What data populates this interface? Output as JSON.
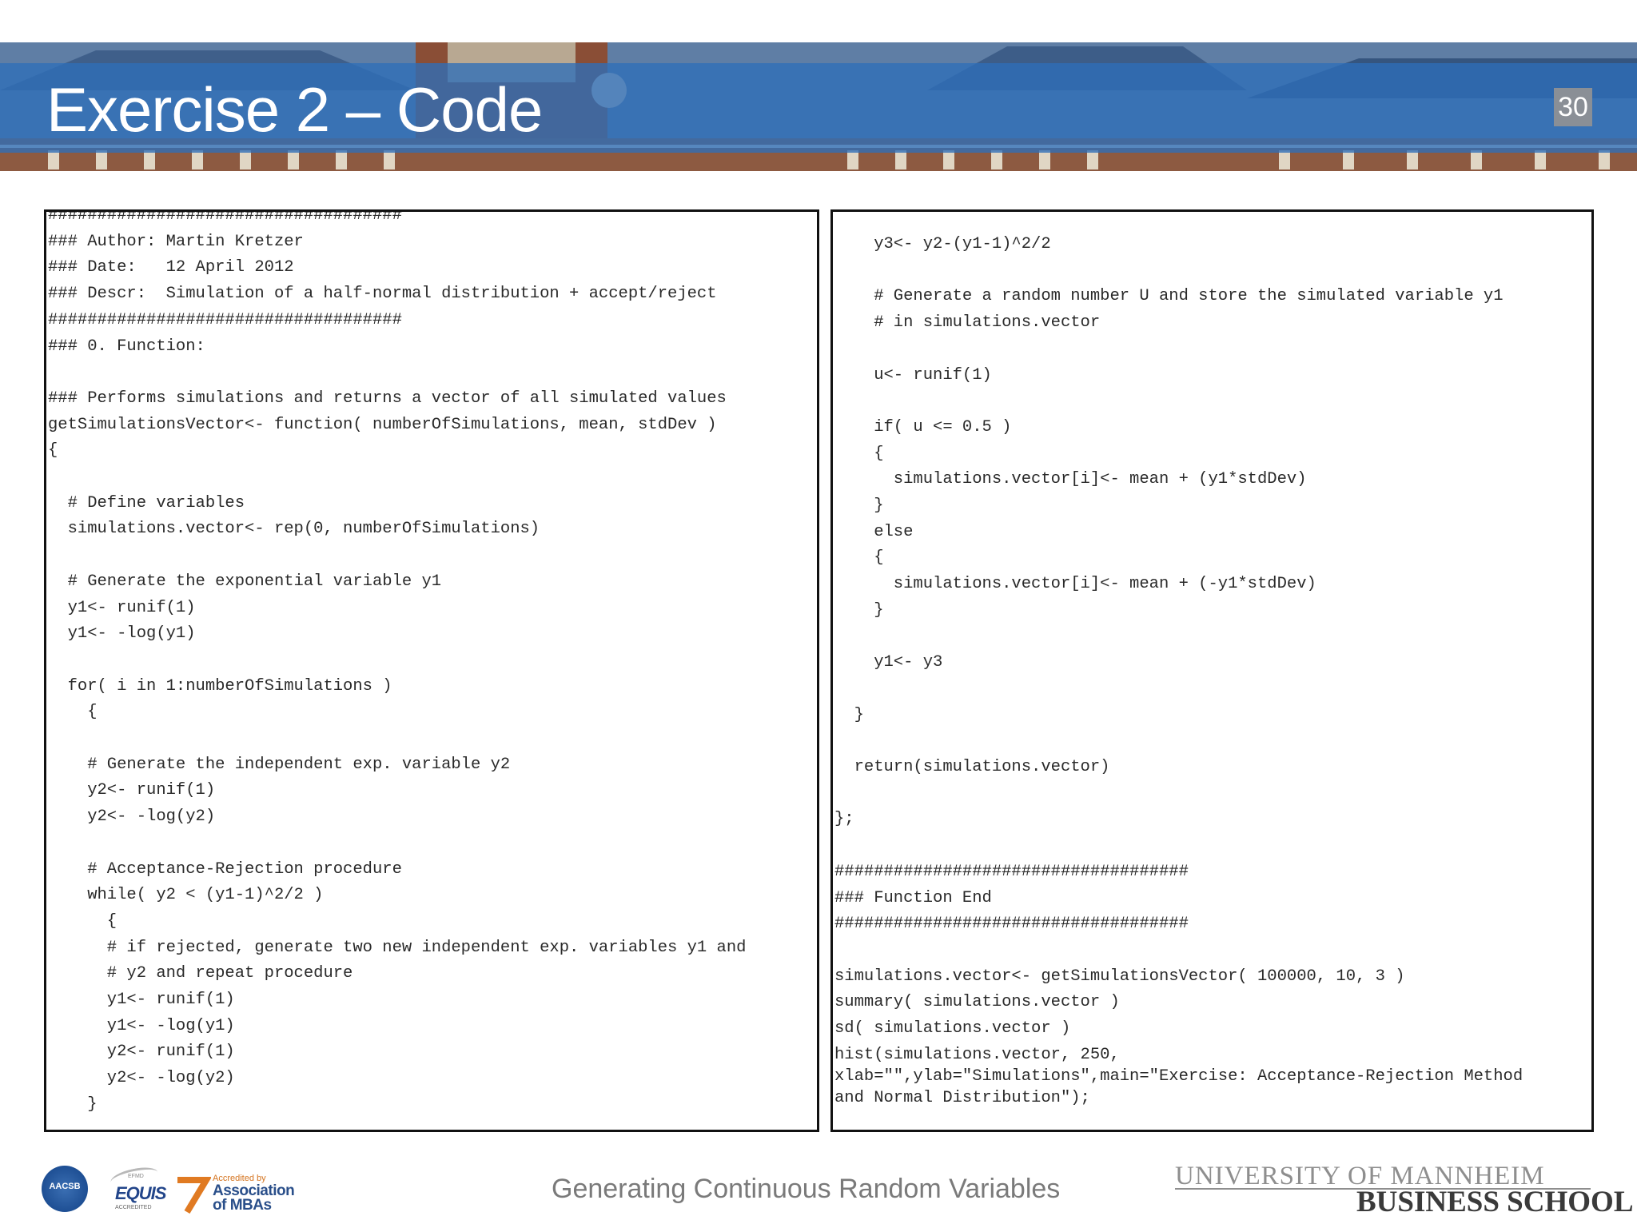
{
  "header": {
    "title": "Exercise 2 – Code",
    "page_number": "30"
  },
  "code": {
    "left": [
      "####################################",
      "### Author: Martin Kretzer",
      "### Date:   12 April 2012",
      "### Descr:  Simulation of a half-normal distribution + accept/reject",
      "####################################",
      "### 0. Function:",
      "",
      "### Performs simulations and returns a vector of all simulated values",
      "getSimulationsVector<- function( numberOfSimulations, mean, stdDev )",
      "{",
      "",
      "  # Define variables",
      "  simulations.vector<- rep(0, numberOfSimulations)",
      "",
      "  # Generate the exponential variable y1",
      "  y1<- runif(1)",
      "  y1<- -log(y1)",
      "",
      "  for( i in 1:numberOfSimulations )",
      "    {",
      "",
      "    # Generate the independent exp. variable y2",
      "    y2<- runif(1)",
      "    y2<- -log(y2)",
      "",
      "    # Acceptance-Rejection procedure",
      "    while( y2 < (y1-1)^2/2 )",
      "      {",
      "      # if rejected, generate two new independent exp. variables y1 and",
      "      # y2 and repeat procedure",
      "      y1<- runif(1)",
      "      y1<- -log(y1)",
      "      y2<- runif(1)",
      "      y2<- -log(y2)",
      "    }"
    ],
    "right": [
      "    y3<- y2-(y1-1)^2/2",
      "",
      "    # Generate a random number U and store the simulated variable y1",
      "    # in simulations.vector",
      "",
      "    u<- runif(1)",
      "",
      "    if( u <= 0.5 )",
      "    {",
      "      simulations.vector[i]<- mean + (y1*stdDev)",
      "    }",
      "    else",
      "    {",
      "      simulations.vector[i]<- mean + (-y1*stdDev)",
      "    }",
      "",
      "    y1<- y3",
      "",
      "  }",
      "",
      "  return(simulations.vector)",
      "",
      "};",
      "",
      "####################################",
      "### Function End",
      "####################################",
      "",
      "simulations.vector<- getSimulationsVector( 100000, 10, 3 )",
      "summary( simulations.vector )",
      "sd( simulations.vector )",
      "hist(simulations.vector, 250,",
      "xlab=\"\",ylab=\"Simulations\",main=\"Exercise: Acceptance-Rejection Method",
      "and Normal Distribution\");"
    ]
  },
  "footer": {
    "title": "Generating Continuous Random Variables",
    "university": "UNIVERSITY OF MANNHEIM",
    "school": "BUSINESS SCHOOL",
    "logos": {
      "aacsb": "AACSB",
      "equis": "EQUIS",
      "equis_top": "EFMD",
      "equis_sub": "ACCREDITED",
      "amba_small": "Accredited by",
      "amba_line1": "Association",
      "amba_line2": "of MBAs"
    }
  }
}
